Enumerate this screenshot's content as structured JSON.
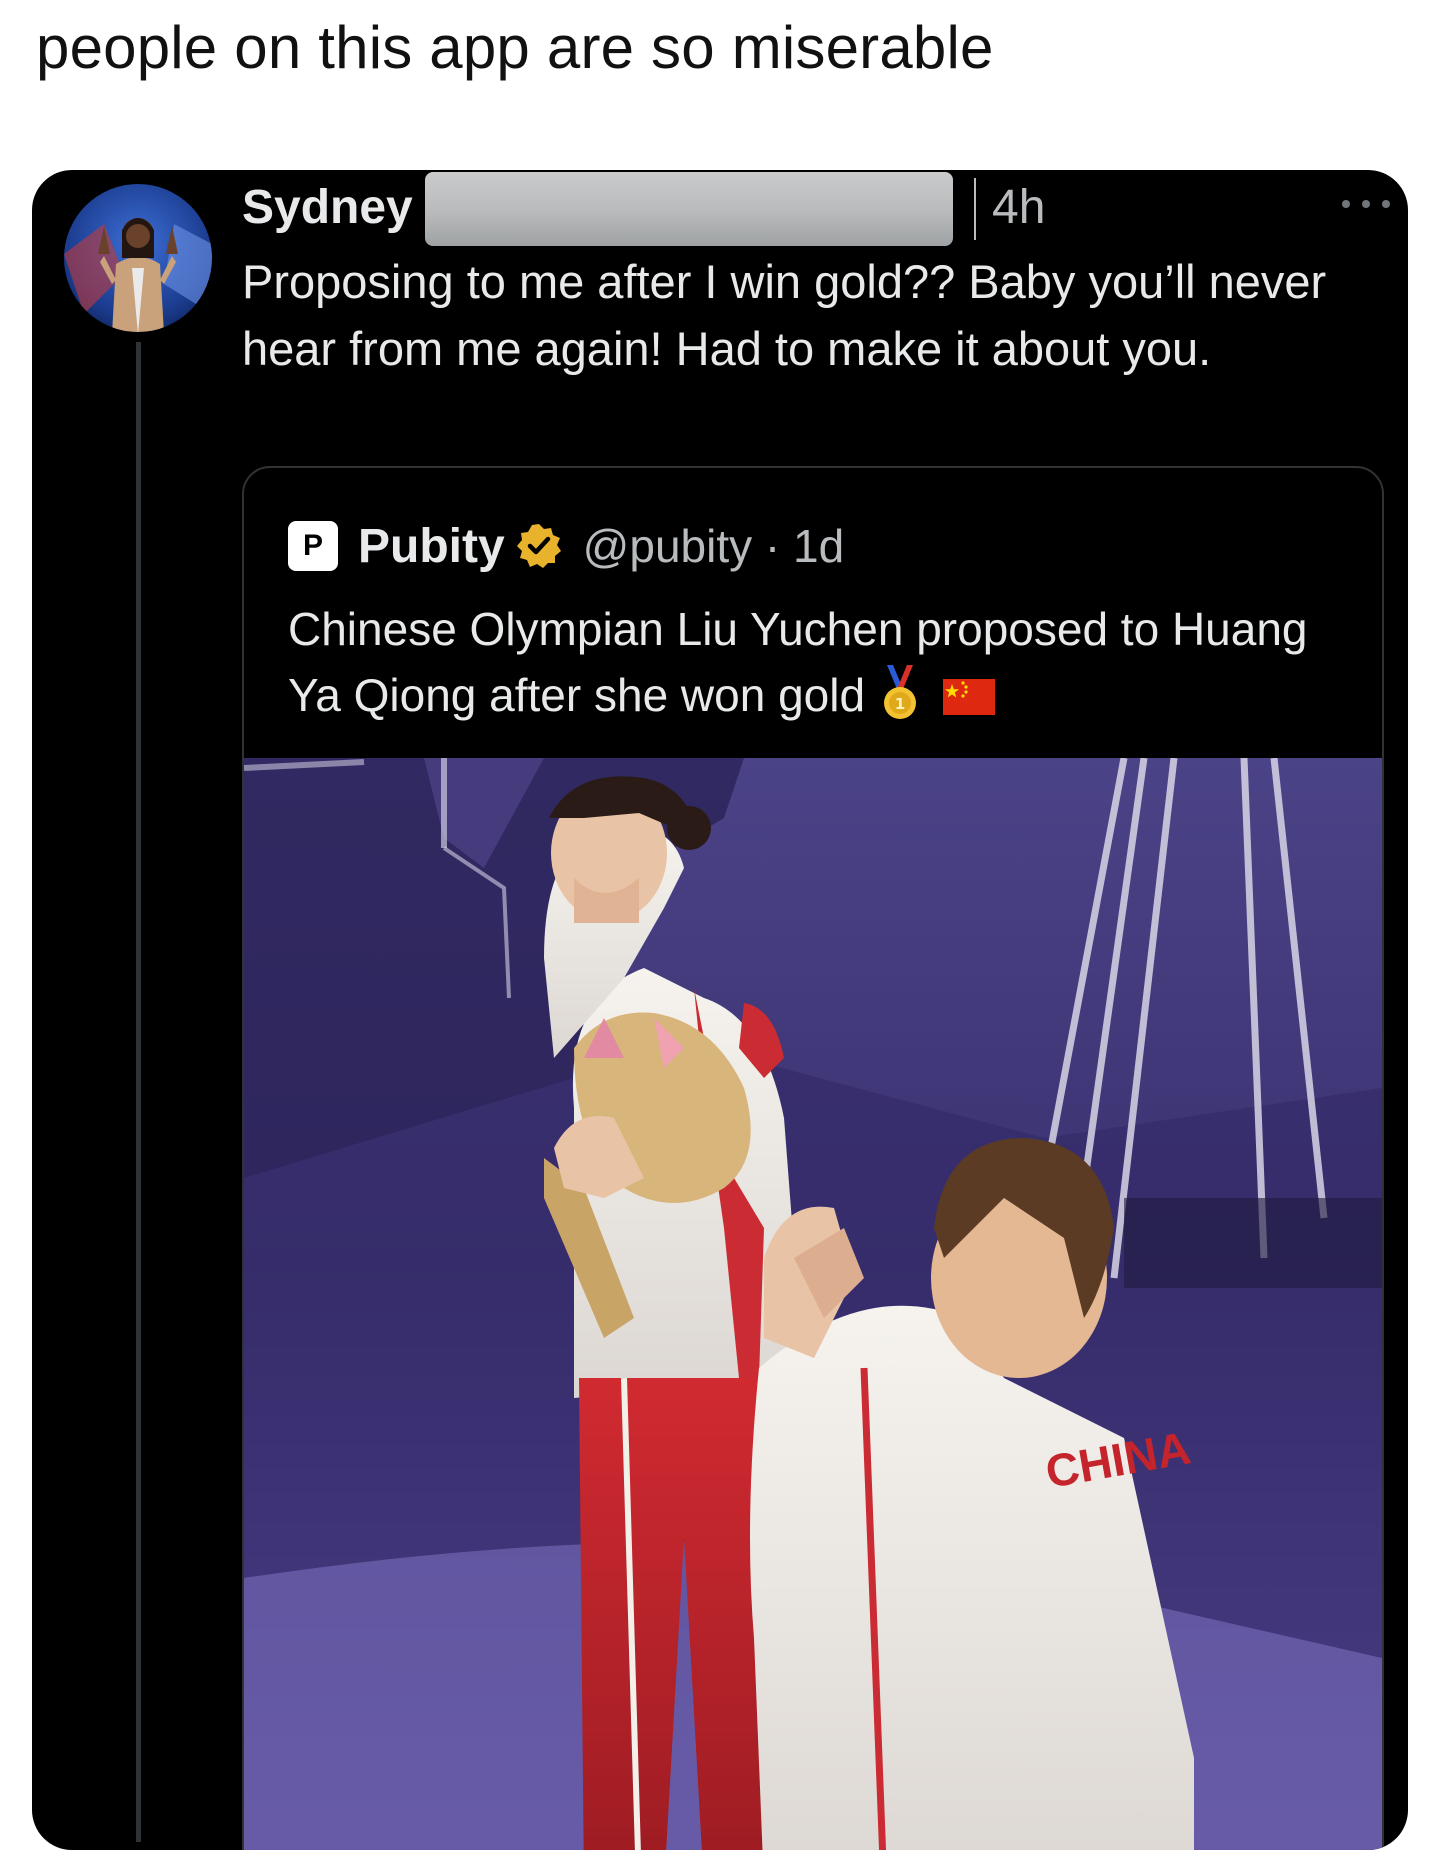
{
  "post": {
    "caption": "people on this app are so miserable"
  },
  "tweet": {
    "author_name": "Sydney",
    "time_ago": "4h",
    "text": "Proposing to me after I win gold?? Baby you’ll never hear from me again! Had to make it about you.",
    "more_icon": "more-horizontal-icon",
    "avatar_icon": "avatar-photo"
  },
  "quote_tweet": {
    "author_name": "Pubity",
    "logo_letter": "P",
    "verified_icon": "verified-badge-icon",
    "handle_time": "@pubity · 1d",
    "text": "Chinese Olympian Liu Yuchen proposed to Huang Ya Qiong after she won gold",
    "emoji_icons": [
      "gold-medal-icon",
      "china-flag-icon"
    ],
    "media": {
      "jacket_text": "CHINA",
      "colors": {
        "stage": "#3c2f6e",
        "jacket_red": "#c4242b",
        "jacket_white": "#f2eee8"
      }
    }
  },
  "colors": {
    "page_bg": "#ffffff",
    "card_bg": "#000000",
    "primary_text": "#e7e9ea",
    "secondary_text": "#b9bcbe",
    "verified_gold": "#e8b22c"
  }
}
